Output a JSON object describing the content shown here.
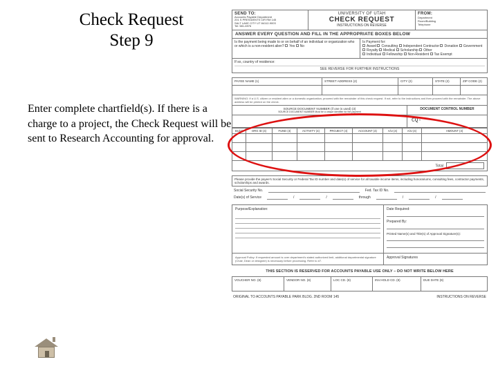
{
  "title": {
    "line1": "Check Request",
    "line2": "Step 9"
  },
  "body": "Enter complete chartfield(s). If there is a charge to a project, the Check Request will be sent to Research Accounting for approval.",
  "form": {
    "header": {
      "send_to_label": "SEND TO:",
      "send_to_body": "Accounts Payable Department\n201 S PRESIDENTS CIR RM 145\nSALT LAKE CITY UT 84112-9003\nTel: 581-6976",
      "university": "UNIVERSITY OF UTAH",
      "title": "CHECK REQUEST",
      "subtitle": "INSTRUCTIONS ON REVERSE",
      "from_label": "FROM:",
      "from_body": "Department\nRoom/Building\nTelephone"
    },
    "banner": "ANSWER EVERY QUESTION AND FILL IN THE APPROPRIATE BOXES BELOW",
    "q_left": "Is the payment being made to or on behalf of an individual or organization who or which is a non-resident alien?",
    "q_opts_yesno": [
      "Yes",
      "No"
    ],
    "q_right_label": "Is Payment for:",
    "q_right_opts": [
      "Award",
      "Consulting",
      "Independent Contractor",
      "Donation",
      "Government",
      "Royalty",
      "Medical",
      "Scholarship",
      "Other",
      "Individual",
      "Fellowship",
      "Non-Resident",
      "Tax Exempt"
    ],
    "residence_label": "If so, country of residence:",
    "residence_center": "SEE REVERSE FOR FURTHER INSTRUCTIONS",
    "payee_cols": [
      "PAYEE NAME (1)",
      "STREET ADDRESS (2)",
      "CITY (2)",
      "STATE (2)",
      "ZIP CODE (2)"
    ],
    "note": "WARNING: If a U.S. citizen or resident alien or a domestic organization, proceed with the remainder of this check request. If not, refer to the instructions and then proceed with the remainder. The above address will be printed on the check.",
    "dcn_left_label": "SOURCE DOCUMENT NUMBER (if one is used) (3)",
    "dcn_left_hint": "SOURCE DOCUMENT NUMBER Must be a unique identifier for the payment",
    "dcn_right_label": "DOCUMENT CONTROL NUMBER",
    "cq_value": "CQ-",
    "cf_cols": [
      "BU(4)",
      "ORG ID (4)",
      "FUND (4)",
      "ACTIVITY (4)",
      "PROJECT (4)",
      "ACCOUNT (4)",
      "A/U (4)",
      "A/U (4)",
      "AMOUNT (4)"
    ],
    "total_label": "Total",
    "invoice_line": "Please provide the payee's Social Security or Federal Tax ID number and date(s) of service for all taxable income items, including honorariums, consulting fees, contractor payments, scholarships and awards.",
    "ssn_label": "Social Security No.",
    "fed_label": "Fed. Tax ID No.",
    "dos_label": "Date(s) of Service",
    "through_label": "through",
    "purpose_label": "Purpose/Explanation:",
    "date_req_label": "Date Required:",
    "prepared_label": "Prepared By:",
    "printed_label": "Printed Name(s) and Title(s) of Approval Signature(s):",
    "policy_label": "Approval Policy: If requested amount is over department's stated authorized limit, additional departmental signature (Chair, Dean or designee) is necessary before processing. Refer to #7.",
    "approval_sig_label": "Approval Signatures",
    "reserved": "THIS SECTION IS RESERVED FOR ACCOUNTS PAYABLE USE ONLY – DO NOT WRITE BELOW HERE",
    "ap_cols": [
      "VOUCHER NO. (8)",
      "VENDOR NO. (8)",
      "LOC CD. (8)",
      "INV.HOLD CD. (8)",
      "DUE DATE (8)"
    ],
    "foot_left": "ORIGINAL TO ACCOUNTS PAYABLE  PARK BLDG. 2ND ROOM 145",
    "foot_right": "INSTRUCTIONS ON REVERSE"
  }
}
